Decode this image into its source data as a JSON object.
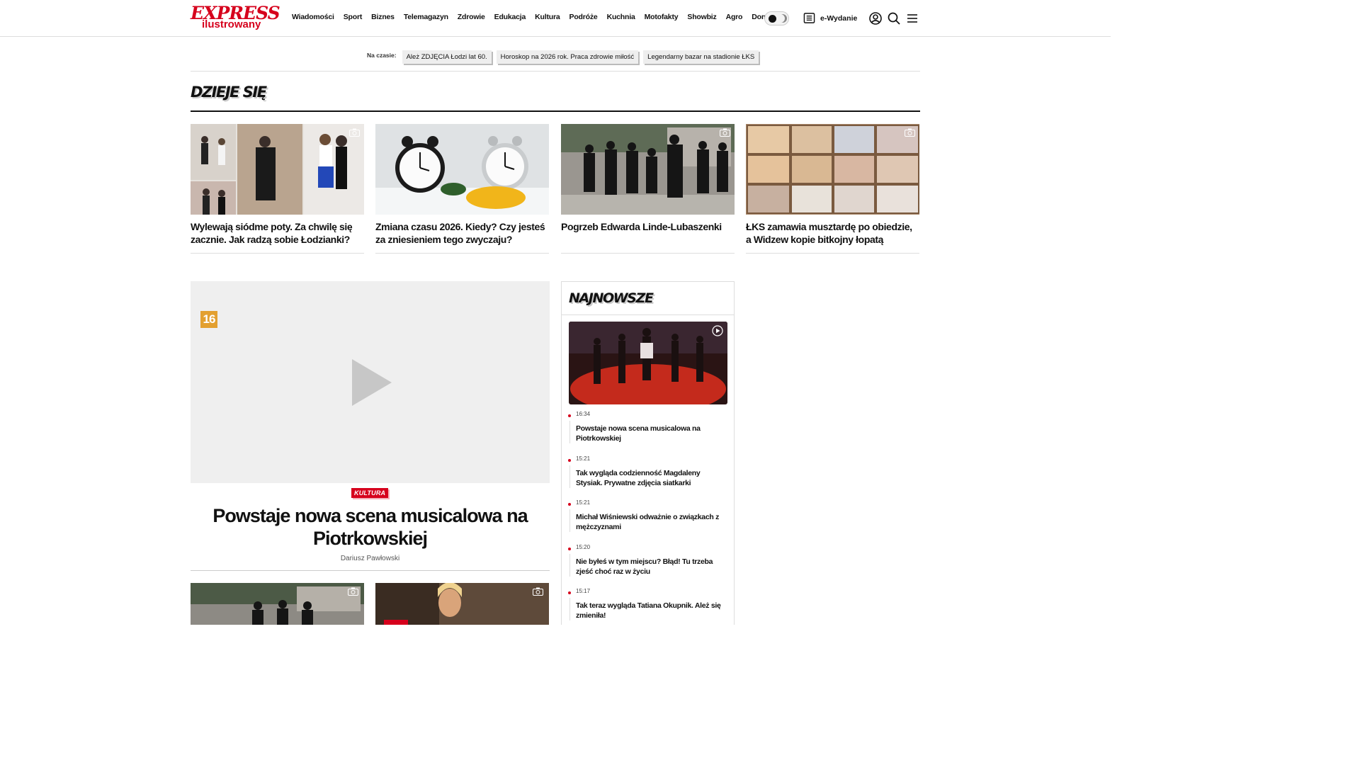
{
  "header": {
    "logo_top": "EXPRESS",
    "logo_bottom": "ilustrowany",
    "nav": [
      "Wiadomości",
      "Sport",
      "Biznes",
      "Telemagazyn",
      "Zdrowie",
      "Edukacja",
      "Kultura",
      "Podróże",
      "Kuchnia",
      "Motofakty",
      "Showbiz",
      "Agro",
      "Dom"
    ],
    "ewydanie": "e-Wydanie"
  },
  "trending": {
    "label": "Na czasie:",
    "chips": [
      "Ależ ZDJĘCIA Łodzi lat 60.",
      "Horoskop na 2026 rok. Praca zdrowie miłość",
      "Legendarny bazar na stadionie ŁKS"
    ]
  },
  "dzieje_sie": {
    "title": "DZIEJE SIĘ",
    "cards": [
      {
        "title": "Wylewają siódme poty. Za chwilę się zacznie. Jak radzą sobie Łodzianki?"
      },
      {
        "title": "Zmiana czasu 2026. Kiedy? Czy jesteś za zniesieniem tego zwyczaju?"
      },
      {
        "title": "Pogrzeb Edwarda Linde-Lubaszenki"
      },
      {
        "title": "ŁKS zamawia musztardę po obiedzie, a Widzew kopie bitkojny łopatą"
      }
    ]
  },
  "featured": {
    "age_rating": "16",
    "category": "KULTURA",
    "title": "Powstaje nowa scena musicalowa na Piotrkowskiej",
    "author": "Dariusz Pawłowski"
  },
  "najnowsze": {
    "title": "NAJNOWSZE",
    "items": [
      {
        "time": "16:34",
        "title": "Powstaje nowa scena musicalowa na Piotrkowskiej"
      },
      {
        "time": "15:21",
        "title": "Tak wygląda codzienność Magdaleny Stysiak. Prywatne zdjęcia siatkarki"
      },
      {
        "time": "15:21",
        "title": "Michał Wiśniewski odważnie o związkach z mężczyznami"
      },
      {
        "time": "15:20",
        "title": "Nie byłeś w tym miejscu? Błąd! Tu trzeba zjeść choć raz w życiu"
      },
      {
        "time": "15:17",
        "title": "Tak teraz wygląda Tatiana Okupnik. Ależ się zmieniła!"
      }
    ]
  },
  "colors": {
    "brand": "#d6001c",
    "age_badge": "#e3a030"
  }
}
